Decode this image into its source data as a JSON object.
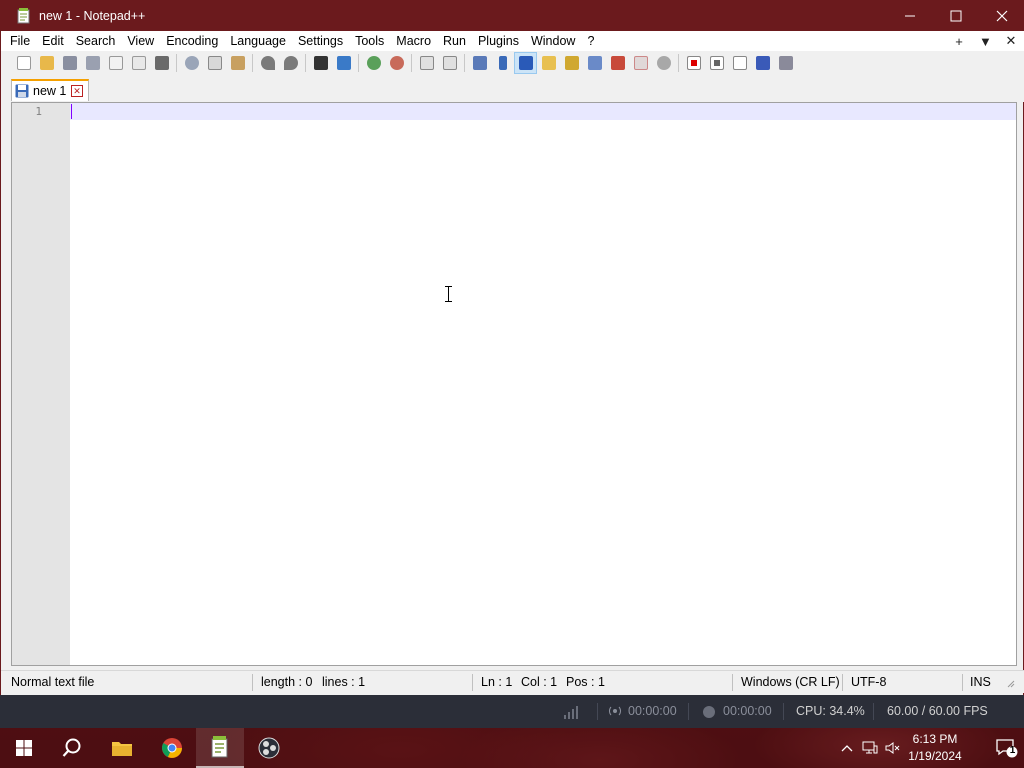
{
  "window": {
    "title": "new 1 - Notepad++"
  },
  "menubar": {
    "items": [
      "File",
      "Edit",
      "Search",
      "View",
      "Encoding",
      "Language",
      "Settings",
      "Tools",
      "Macro",
      "Run",
      "Plugins",
      "Window",
      "?"
    ],
    "right_buttons": [
      "+",
      "▼",
      "✕"
    ]
  },
  "toolbar": {
    "icons": [
      "new-file",
      "open-file",
      "save",
      "save-all",
      "close",
      "close-all",
      "print",
      "cut",
      "copy",
      "paste",
      "undo",
      "redo",
      "find",
      "replace",
      "zoom-in",
      "zoom-out",
      "sync-vertical",
      "sync-horizontal",
      "word-wrap",
      "show-all-chars",
      "indent-guide",
      "user-defined-language",
      "document-map",
      "function-list",
      "folder-as-workspace",
      "monitoring",
      "record-macro",
      "stop-recording",
      "playback-macro",
      "run-macro-multiple",
      "save-macro"
    ]
  },
  "tabs": [
    {
      "label": "new 1",
      "active": true
    }
  ],
  "editor": {
    "line_numbers": [
      "1"
    ]
  },
  "statusbar": {
    "file_type": "Normal text file",
    "length": "length : 0",
    "lines": "lines : 1",
    "ln": "Ln : 1",
    "col": "Col : 1",
    "pos": "Pos : 1",
    "eol": "Windows (CR LF)",
    "encoding": "UTF-8",
    "mode": "INS"
  },
  "obs": {
    "stream_time": "00:00:00",
    "record_time": "00:00:00",
    "cpu": "CPU: 34.4%",
    "fps": "60.00 / 60.00 FPS"
  },
  "taskbar": {
    "apps": [
      "start-icon",
      "search-icon",
      "file-explorer-icon",
      "chrome-icon",
      "notepadpp-icon",
      "obs-icon"
    ],
    "time": "6:13 PM",
    "date": "1/19/2024",
    "notification_count": "1"
  },
  "colors": {
    "titlebar": "#6b1a1d",
    "tab_accent": "#f5a000",
    "current_line": "#e8e8ff",
    "caret": "#8000ff",
    "obs_bar": "#2b2e38"
  }
}
